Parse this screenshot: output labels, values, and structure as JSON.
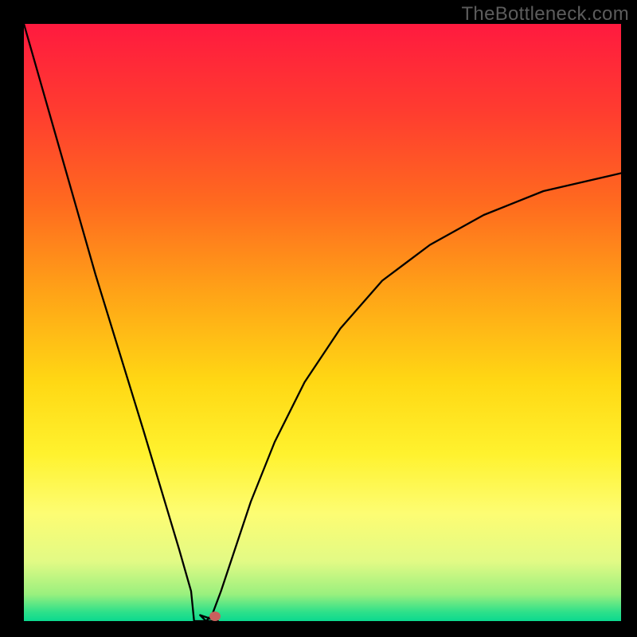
{
  "watermark": "TheBottleneck.com",
  "chart_data": {
    "type": "line",
    "title": "",
    "xlabel": "",
    "ylabel": "",
    "xlim": [
      0,
      100
    ],
    "ylim": [
      0,
      100
    ],
    "grid": false,
    "legend": false,
    "background_gradient": {
      "stops": [
        {
          "offset": 0.0,
          "color": "#ff1a3f"
        },
        {
          "offset": 0.15,
          "color": "#ff3d2f"
        },
        {
          "offset": 0.3,
          "color": "#ff6a1f"
        },
        {
          "offset": 0.45,
          "color": "#ffa317"
        },
        {
          "offset": 0.6,
          "color": "#ffd814"
        },
        {
          "offset": 0.72,
          "color": "#fff22e"
        },
        {
          "offset": 0.82,
          "color": "#fdfd73"
        },
        {
          "offset": 0.9,
          "color": "#e2fa85"
        },
        {
          "offset": 0.955,
          "color": "#9af07e"
        },
        {
          "offset": 0.985,
          "color": "#2de08a"
        },
        {
          "offset": 1.0,
          "color": "#0bd98f"
        }
      ]
    },
    "series": [
      {
        "name": "bottleneck-curve",
        "color": "#000000",
        "stroke_width": 2.3,
        "x": [
          0,
          4,
          8,
          12,
          16,
          20,
          23,
          26,
          28,
          29.5,
          30.5,
          31.5,
          33,
          35,
          38,
          42,
          47,
          53,
          60,
          68,
          77,
          87,
          100
        ],
        "y": [
          100,
          86,
          72,
          58,
          45,
          32,
          22,
          12,
          5,
          1,
          0,
          1,
          5,
          11,
          20,
          30,
          40,
          49,
          57,
          63,
          68,
          72,
          75
        ]
      }
    ],
    "flat_segment": {
      "x_start": 28.5,
      "x_end": 32.5,
      "y": 0
    },
    "marker": {
      "x": 32,
      "y": 0.8,
      "color": "#c9605d",
      "rx": 7,
      "ry": 6
    }
  }
}
